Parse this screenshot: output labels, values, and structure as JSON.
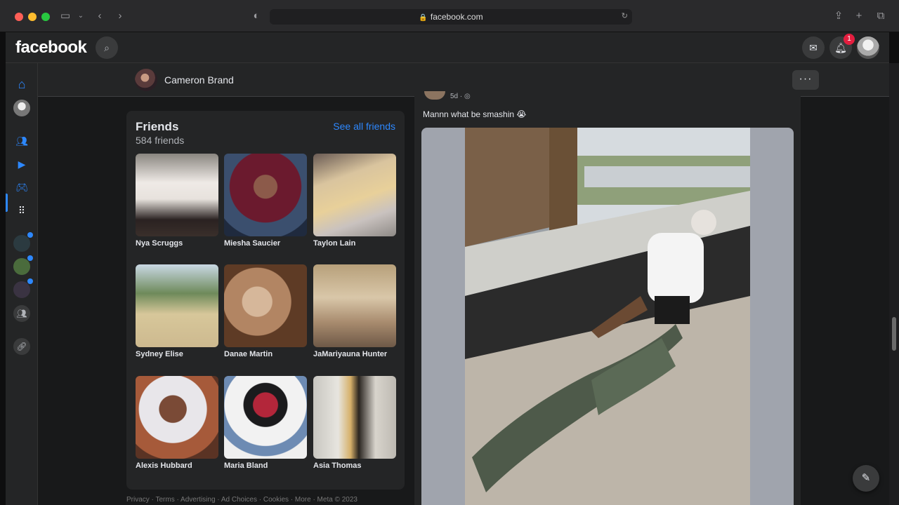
{
  "browser": {
    "url": "facebook.com"
  },
  "header": {
    "logo": "facebook",
    "notifications_count": "1"
  },
  "profile_strip": {
    "name": "Cameron Brand",
    "more_label": "···"
  },
  "friends": {
    "title": "Friends",
    "count": "584 friends",
    "see_all": "See all friends",
    "items": [
      {
        "name": "Nya Scruggs"
      },
      {
        "name": "Miesha Saucier"
      },
      {
        "name": "Taylon Lain"
      },
      {
        "name": "Sydney Elise"
      },
      {
        "name": "Danae Martin"
      },
      {
        "name": "JaMariyauna Hunter"
      },
      {
        "name": "Alexis Hubbard"
      },
      {
        "name": "Maria Bland"
      },
      {
        "name": "Asia Thomas"
      }
    ]
  },
  "footer": {
    "links": "Privacy · Terms · Advertising · Ad Choices · Cookies · More · Meta © 2023"
  },
  "post": {
    "time": "5d ·",
    "text": "Mannn what be smashin 😭"
  },
  "colors": {
    "accent": "#2d88ff",
    "badge": "#e41e3f"
  }
}
